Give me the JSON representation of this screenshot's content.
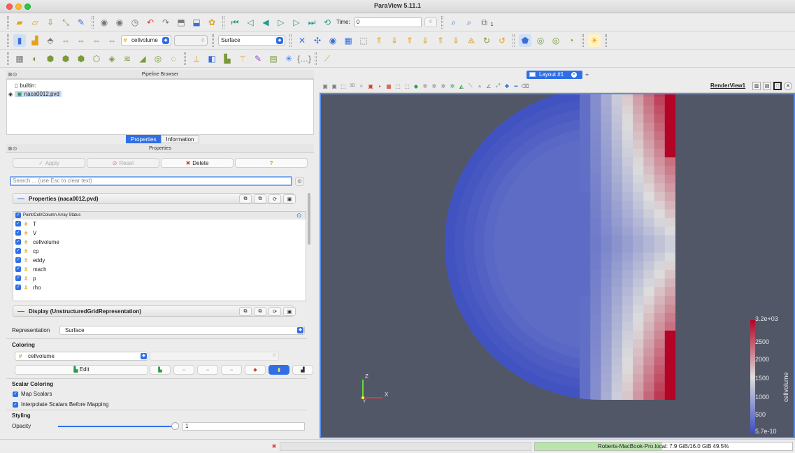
{
  "window": {
    "title": "ParaView 5.11.1"
  },
  "toolbar1": {
    "time_label": "Time:",
    "time_value": "0",
    "timestep": "1"
  },
  "toolbar2": {
    "array_select": "cellvolume",
    "representation_select": "Surface"
  },
  "pipeline": {
    "header": "Pipeline Browser",
    "builtin": "builtin:",
    "source": "naca0012.pvd"
  },
  "tabs": {
    "properties": "Properties",
    "information": "Information"
  },
  "properties": {
    "header": "Properties",
    "apply": "Apply",
    "reset": "Reset",
    "delete": "Delete",
    "help": "?",
    "search_placeholder": "Search ... (use Esc to clear text)",
    "section_properties": "Properties (naca0012.pvd)",
    "array_header": "Point/Cell/Column Array Status",
    "arrays": [
      "T",
      "V",
      "cellvolume",
      "cp",
      "eddy",
      "mach",
      "p",
      "rho"
    ],
    "section_display": "Display (UnstructuredGridRepresentation)",
    "representation_label": "Representation",
    "representation_value": "Surface",
    "coloring_label": "Coloring",
    "coloring_value": "cellvolume",
    "edit_label": "Edit",
    "scalar_coloring_label": "Scalar Coloring",
    "map_scalars": "Map Scalars",
    "interpolate_scalars": "Interpolate Scalars Before Mapping",
    "styling_label": "Styling",
    "opacity_label": "Opacity",
    "opacity_value": "1",
    "opacity_fraction": 1
  },
  "layout": {
    "tab_label": "Layout #1",
    "plus": "+"
  },
  "render_view": {
    "name": "RenderView1"
  },
  "colorbar": {
    "title": "cellvolume",
    "labels": [
      "3.2e+03",
      "2500",
      "2000",
      "1500",
      "1000",
      "500",
      "5.7e-10"
    ],
    "max": 3200,
    "min": 5.7e-10,
    "colors": [
      "#3b4cc0",
      "#dddddd",
      "#b40426"
    ]
  },
  "axes": {
    "z": "Z",
    "x": "X",
    "y": "Y"
  },
  "statusbar": {
    "memory": "Roberts-MacBook-Pro.local: 7.9 GiB/16.0 GiB 49.5%",
    "memory_percent": 49.5
  }
}
